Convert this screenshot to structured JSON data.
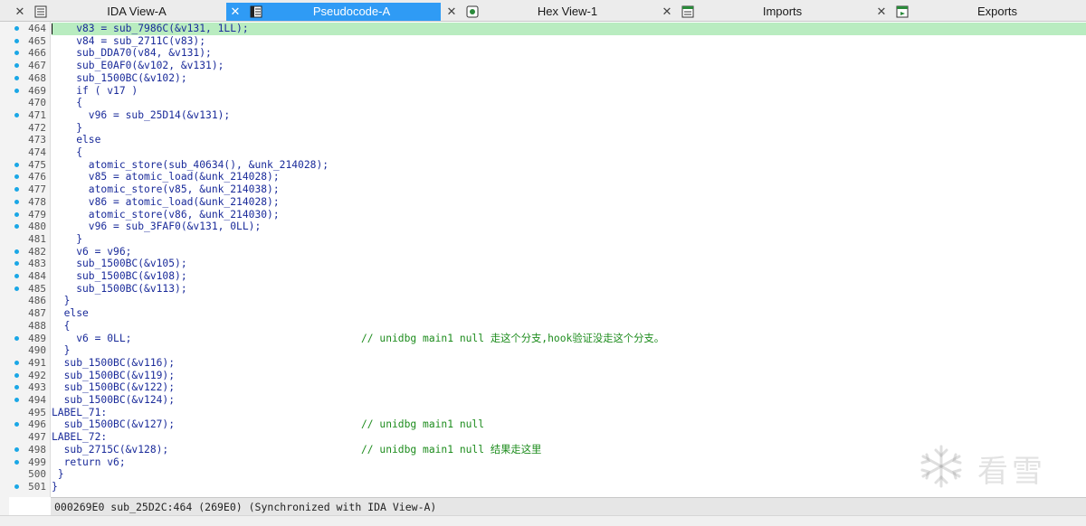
{
  "tabs": [
    {
      "label": "IDA View-A",
      "icon": "ida-view-icon",
      "active": false
    },
    {
      "label": "Pseudocode-A",
      "icon": "pseudocode-icon",
      "active": true
    },
    {
      "label": "Hex View-1",
      "icon": "hex-view-icon",
      "active": false
    },
    {
      "label": "Imports",
      "icon": "imports-icon",
      "active": false
    },
    {
      "label": "Exports",
      "icon": "exports-icon",
      "active": false
    }
  ],
  "colors": {
    "active_tab": "#2f9bf5",
    "highlight_line": "#b9ecc0",
    "code_text": "#1a2b9a",
    "comment": "#1d8c1d",
    "breakpoint_dot": "#1aa7e6"
  },
  "lines": [
    {
      "num": "464",
      "dot": true,
      "text": "    v83 = sub_7986C(&v131, 1LL);",
      "comment": ""
    },
    {
      "num": "465",
      "dot": true,
      "text": "    v84 = sub_2711C(v83);",
      "comment": ""
    },
    {
      "num": "466",
      "dot": true,
      "text": "    sub_DDA70(v84, &v131);",
      "comment": ""
    },
    {
      "num": "467",
      "dot": true,
      "text": "    sub_E0AF0(&v102, &v131);",
      "comment": ""
    },
    {
      "num": "468",
      "dot": true,
      "text": "    sub_1500BC(&v102);",
      "comment": ""
    },
    {
      "num": "469",
      "dot": true,
      "text": "    if ( v17 )",
      "comment": ""
    },
    {
      "num": "470",
      "dot": false,
      "text": "    {",
      "comment": ""
    },
    {
      "num": "471",
      "dot": true,
      "text": "      v96 = sub_25D14(&v131);",
      "comment": ""
    },
    {
      "num": "472",
      "dot": false,
      "text": "    }",
      "comment": ""
    },
    {
      "num": "473",
      "dot": false,
      "text": "    else",
      "comment": ""
    },
    {
      "num": "474",
      "dot": false,
      "text": "    {",
      "comment": ""
    },
    {
      "num": "475",
      "dot": true,
      "text": "      atomic_store(sub_40634(), &unk_214028);",
      "comment": ""
    },
    {
      "num": "476",
      "dot": true,
      "text": "      v85 = atomic_load(&unk_214028);",
      "comment": ""
    },
    {
      "num": "477",
      "dot": true,
      "text": "      atomic_store(v85, &unk_214038);",
      "comment": ""
    },
    {
      "num": "478",
      "dot": true,
      "text": "      v86 = atomic_load(&unk_214028);",
      "comment": ""
    },
    {
      "num": "479",
      "dot": true,
      "text": "      atomic_store(v86, &unk_214030);",
      "comment": ""
    },
    {
      "num": "480",
      "dot": true,
      "text": "      v96 = sub_3FAF0(&v131, 0LL);",
      "comment": ""
    },
    {
      "num": "481",
      "dot": false,
      "text": "    }",
      "comment": ""
    },
    {
      "num": "482",
      "dot": true,
      "text": "    v6 = v96;",
      "comment": ""
    },
    {
      "num": "483",
      "dot": true,
      "text": "    sub_1500BC(&v105);",
      "comment": ""
    },
    {
      "num": "484",
      "dot": true,
      "text": "    sub_1500BC(&v108);",
      "comment": ""
    },
    {
      "num": "485",
      "dot": true,
      "text": "    sub_1500BC(&v113);",
      "comment": ""
    },
    {
      "num": "486",
      "dot": false,
      "text": "  }",
      "comment": ""
    },
    {
      "num": "487",
      "dot": false,
      "text": "  else",
      "comment": ""
    },
    {
      "num": "488",
      "dot": false,
      "text": "  {",
      "comment": ""
    },
    {
      "num": "489",
      "dot": true,
      "text": "    v6 = 0LL;",
      "comment": "// unidbg main1 null 走这个分支,hook验证没走这个分支。"
    },
    {
      "num": "490",
      "dot": false,
      "text": "  }",
      "comment": ""
    },
    {
      "num": "491",
      "dot": true,
      "text": "  sub_1500BC(&v116);",
      "comment": ""
    },
    {
      "num": "492",
      "dot": true,
      "text": "  sub_1500BC(&v119);",
      "comment": ""
    },
    {
      "num": "493",
      "dot": true,
      "text": "  sub_1500BC(&v122);",
      "comment": ""
    },
    {
      "num": "494",
      "dot": true,
      "text": "  sub_1500BC(&v124);",
      "comment": ""
    },
    {
      "num": "495",
      "dot": false,
      "text": "LABEL_71:",
      "comment": ""
    },
    {
      "num": "496",
      "dot": true,
      "text": "  sub_1500BC(&v127);",
      "comment": "// unidbg main1 null"
    },
    {
      "num": "497",
      "dot": false,
      "text": "LABEL_72:",
      "comment": ""
    },
    {
      "num": "498",
      "dot": true,
      "text": "  sub_2715C(&v128);",
      "comment": "// unidbg main1 null 结果走这里"
    },
    {
      "num": "499",
      "dot": true,
      "text": "  return v6;",
      "comment": ""
    },
    {
      "num": "500",
      "dot": false,
      "text": " }",
      "comment": ""
    },
    {
      "num": "501",
      "dot": true,
      "text": "}",
      "comment": ""
    }
  ],
  "status": {
    "text": "000269E0 sub_25D2C:464 (269E0) (Synchronized with IDA View-A)"
  },
  "watermark": {
    "text": "看雪",
    "icon": "snowflake-icon"
  }
}
